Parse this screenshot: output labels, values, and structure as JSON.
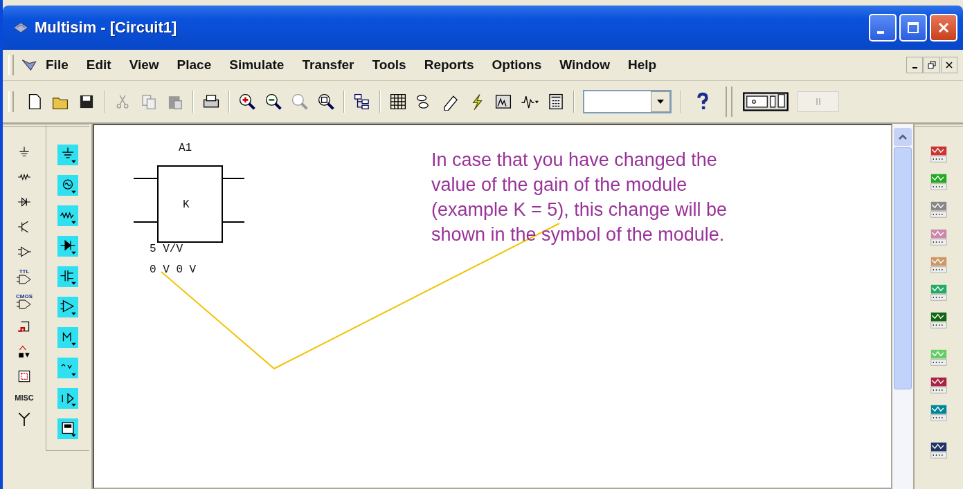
{
  "window": {
    "title": "Multisim - [Circuit1]"
  },
  "menu": [
    "File",
    "Edit",
    "View",
    "Place",
    "Simulate",
    "Transfer",
    "Tools",
    "Reports",
    "Options",
    "Window",
    "Help"
  ],
  "component_palette": {
    "badges": [
      "TTL",
      "CMOS"
    ],
    "misc": "MISC"
  },
  "schematic": {
    "ref": "A1",
    "symbol": "K",
    "gain": "5 V/V",
    "offsets": "0 V 0 V"
  },
  "annotation": "In case that you have changed the value of the gain of the module (example K = 5), this change will be shown in the symbol of the module."
}
